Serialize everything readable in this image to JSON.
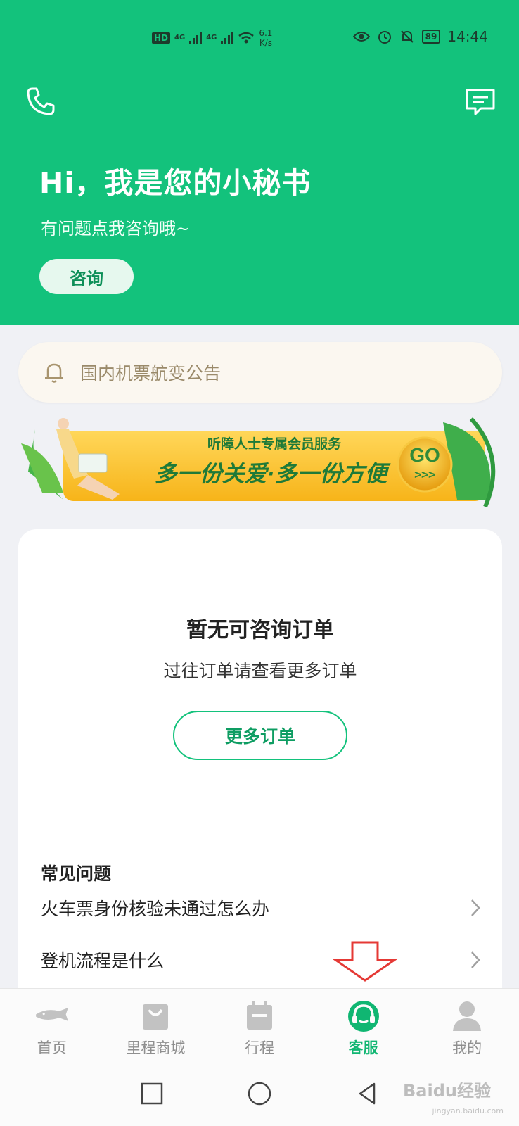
{
  "status_bar": {
    "left_tag": "HD",
    "network_1": "4G",
    "network_2": "4G",
    "speed_value": "6.1",
    "speed_unit": "K/s",
    "battery": "89",
    "time": "14:44"
  },
  "header": {
    "title": "Hi，我是您的小秘书",
    "subtitle": "有问题点我咨询哦~",
    "consult_label": "咨询"
  },
  "notice": {
    "text": "国内机票航变公告"
  },
  "banner": {
    "line1": "听障人士专属会员服务",
    "line2": "多一份关爱·多一份方便",
    "go": "GO",
    "go_arrows": ">>>"
  },
  "orders": {
    "empty_title": "暂无可咨询订单",
    "empty_sub": "过往订单请查看更多订单",
    "more_label": "更多订单"
  },
  "faq": {
    "title": "常见问题",
    "items": [
      {
        "label": "火车票身份核验未通过怎么办"
      },
      {
        "label": "登机流程是什么"
      }
    ]
  },
  "tabs": [
    {
      "label": "首页",
      "icon": "home-plane-icon"
    },
    {
      "label": "里程商城",
      "icon": "shopping-bag-icon"
    },
    {
      "label": "行程",
      "icon": "calendar-icon"
    },
    {
      "label": "客服",
      "icon": "headset-icon",
      "active": true
    },
    {
      "label": "我的",
      "icon": "person-icon"
    }
  ],
  "colors": {
    "brand": "#13c27c",
    "active_tab": "#10b672",
    "notice_text": "#9a8a6a",
    "arrow": "#e53935"
  },
  "watermark": {
    "brand": "Baidu经验",
    "url": "jingyan.baidu.com"
  }
}
